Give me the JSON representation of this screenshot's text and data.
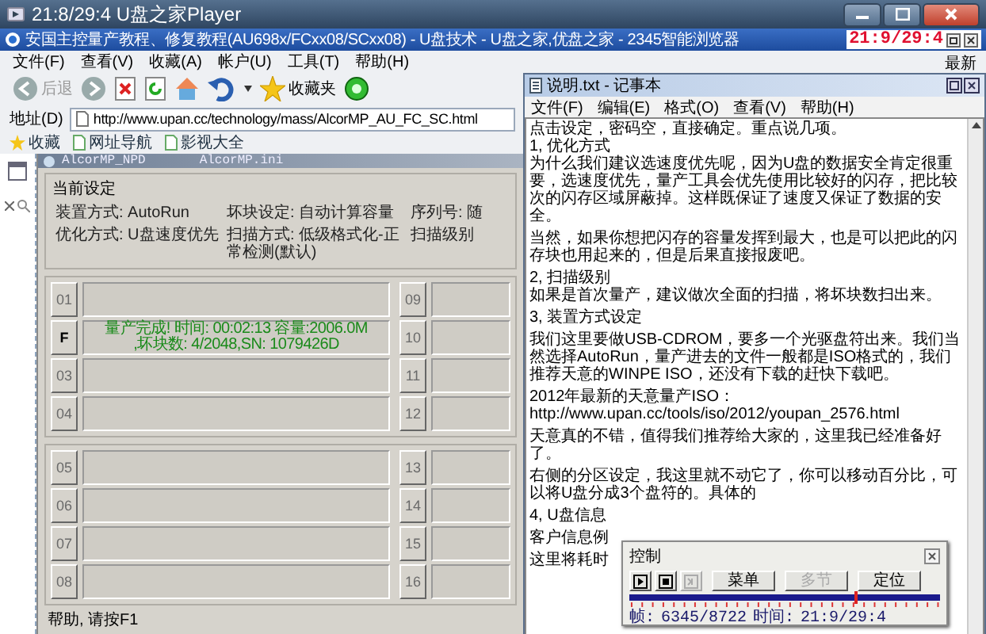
{
  "player": {
    "title": "21:8/29:4 U盘之家Player"
  },
  "clock": {
    "time": "21:9/29:4"
  },
  "browser": {
    "title": "安国主控量产教程、修复教程(AU698x/FCxx08/SCxx08) - U盘技术 - U盘之家,优盘之家 - 2345智能浏览器",
    "menu": [
      "文件(F)",
      "查看(V)",
      "收藏(A)",
      "帐户(U)",
      "工具(T)",
      "帮助(H)"
    ],
    "menu_extra": "最新",
    "toolbar": {
      "back_label": "后退",
      "favorites_label": "收藏夹"
    },
    "address": {
      "label": "地址(D)",
      "url": "http://www.upan.cc/technology/mass/AlcorMP_AU_FC_SC.html"
    },
    "bookmarks": [
      "收藏",
      "网址导航",
      "影视大全"
    ]
  },
  "app": {
    "title": "AlcorMP_NPD",
    "ini_file": "AlcorMP.ini",
    "settings_title": "当前设定",
    "settings": [
      [
        "装置方式: AutoRun",
        "坏块设定: 自动计算容量",
        "序列号: 随"
      ],
      [
        "优化方式: U盘速度优先",
        "扫描方式: 低级格式化-正常检测(默认)",
        "扫描级别"
      ]
    ],
    "slot_panels": [
      {
        "left": [
          {
            "label": "01",
            "active": false
          },
          {
            "label": "F",
            "active": true,
            "status": [
              "量产完成! 时间: 00:02:13 容量:2006.0M",
              ",坏块数: 4/2048,SN: 1079426D"
            ]
          },
          {
            "label": "03",
            "active": false
          },
          {
            "label": "04",
            "active": false
          }
        ],
        "right": [
          {
            "label": "09",
            "active": false
          },
          {
            "label": "10",
            "active": false
          },
          {
            "label": "11",
            "active": false
          },
          {
            "label": "12",
            "active": false
          }
        ]
      },
      {
        "left": [
          {
            "label": "05",
            "active": false
          },
          {
            "label": "06",
            "active": false
          },
          {
            "label": "07",
            "active": false
          },
          {
            "label": "08",
            "active": false
          }
        ],
        "right": [
          {
            "label": "13",
            "active": false
          },
          {
            "label": "14",
            "active": false
          },
          {
            "label": "15",
            "active": false
          },
          {
            "label": "16",
            "active": false
          }
        ]
      }
    ],
    "status_bar": "帮助, 请按F1"
  },
  "notepad": {
    "title": "说明.txt - 记事本",
    "menu": [
      "文件(F)",
      "编辑(E)",
      "格式(O)",
      "查看(V)",
      "帮助(H)"
    ],
    "blocks": [
      [
        "点击设定，密码空，直接确定。重点说几项。",
        "1, 优化方式",
        "为什么我们建议选速度优先呢，因为U盘的数据安全肯定很重要，选速度优先，量产工具会优先使用比较好的闪存，把比较次的闪存区域屏蔽掉。这样既保证了速度又保证了数据的安全。"
      ],
      [
        "当然，如果你想把闪存的容量发挥到最大，也是可以把此的闪存块也用起来的，但是后果直接报废吧。"
      ],
      [
        "2, 扫描级别",
        "如果是首次量产，建议做次全面的扫描，将坏块数扫出来。"
      ],
      [
        "3, 装置方式设定"
      ],
      [
        "我们这里要做USB-CDROM，要多一个光驱盘符出来。我们当然选择AutoRun，量产进去的文件一般都是ISO格式的，我们推荐天意的WINPE ISO，还没有下载的赶快下载吧。"
      ],
      [
        "2012年最新的天意量产ISO：",
        "http://www.upan.cc/tools/iso/2012/youpan_2576.html"
      ],
      [
        "天意真的不错，值得我们推荐给大家的，这里我已经准备好了。"
      ],
      [
        "右侧的分区设定，我这里就不动它了，你可以移动百分比，可以将U盘分成3个盘符的。具体的"
      ],
      [
        "4, U盘信息"
      ],
      [
        "客户信息例"
      ],
      [
        "这里将耗时"
      ]
    ]
  },
  "control": {
    "title": "控制",
    "icon_buttons": [
      {
        "kind": "play",
        "disabled": false
      },
      {
        "kind": "stop",
        "disabled": false
      },
      {
        "kind": "step",
        "disabled": true
      }
    ],
    "buttons": [
      {
        "label": "菜单",
        "disabled": false
      },
      {
        "label": "多节",
        "disabled": true
      },
      {
        "label": "定位",
        "disabled": false
      }
    ],
    "position": {
      "level": 0.73
    },
    "frame_label": "帧:",
    "frame": "6345/8722",
    "time_label": "时间:",
    "time": "21:9/29:4"
  }
}
